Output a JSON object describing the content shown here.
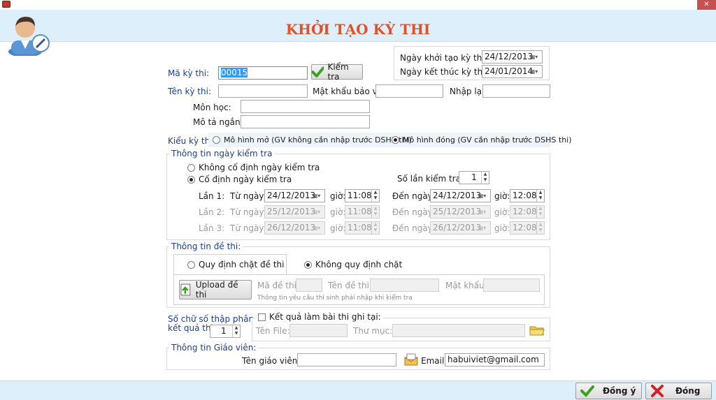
{
  "window": {
    "close_glyph": "✕"
  },
  "header": {
    "title": "KHỞI TẠO KỲ THI",
    "avatar_icon": "teacher-avatar-icon"
  },
  "dates": {
    "start_label": "Ngày khởi tạo kỳ thi:",
    "start_value": "24/12/2013",
    "end_label": "Ngày kết thúc kỳ thi:",
    "end_value": "24/01/2014"
  },
  "exam": {
    "code_label": "Mã kỳ thi:",
    "code_value": "00015",
    "check_button": "Kiểm tra",
    "name_label": "Tên kỳ thi:",
    "name_value": "",
    "password_label": "Mật khẩu bảo vệ:",
    "password_value": "",
    "reenter_label": "Nhập lại:",
    "reenter_value": "",
    "subject_label": "Môn học:",
    "subject_value": "",
    "desc_label": "Mô tả ngắn:",
    "desc_value": ""
  },
  "exam_type": {
    "label": "Kiểu kỳ thi:",
    "open_option": "Mô hình mở (GV không cần nhập trước DSHS thi)",
    "closed_option": "Mô hình đóng (GV cần nhập trước DSHS thi)",
    "selected": "closed"
  },
  "schedule": {
    "title": "Thông tin ngày kiểm tra",
    "not_fixed": "Không cố định ngày kiểm tra",
    "fixed": "Cố định ngày kiểm tra",
    "count_label": "Số lần kiểm tra:",
    "count_value": "1",
    "from_label": "Từ ngày:",
    "to_label": "Đến ngày:",
    "time_label": "giờ:",
    "rows": [
      {
        "label": "Lần 1:",
        "from_date": "24/12/2013",
        "from_time": "11:08",
        "to_date": "24/12/2013",
        "to_time": "12:08"
      },
      {
        "label": "Lần 2:",
        "from_date": "25/12/2013",
        "from_time": "11:08",
        "to_date": "25/12/2013",
        "to_time": "12:08"
      },
      {
        "label": "Lần 3:",
        "from_date": "26/12/2013",
        "from_time": "11:08",
        "to_date": "26/12/2013",
        "to_time": "12:08"
      }
    ]
  },
  "paper": {
    "title": "Thông tin đề thi:",
    "tab_strict": "Quy định chặt đề thi",
    "tab_loose": "Không quy định chặt",
    "upload_button": "Upload đề thi",
    "code_label": "Mã đề thi:",
    "name_label": "Tên đề thi:",
    "password_label": "Mật khẩu:",
    "hint": "Thông tin yêu cầu thí sinh phải nhập khi kiểm tra"
  },
  "decimal": {
    "label_line1": "Số chữ số thập phân",
    "label_line2": "kết quả thi:",
    "value": "1"
  },
  "result_save": {
    "checkbox_label": "Kết quả làm bài thi ghi tại:",
    "file_label": "Tên File:",
    "folder_label": "Thư mục:"
  },
  "teacher": {
    "title": "Thông tin Giáo viên:",
    "name_label": "Tên giáo viên:",
    "name_value": "",
    "email_label": "Email:",
    "email_value": "habuiviet@gmail.com"
  },
  "footer": {
    "ok": "Đồng ý",
    "close": "Đóng"
  },
  "colors": {
    "header_bg": "#dceffa",
    "title": "#e0522a",
    "label_blue": "#1c3f8f",
    "ok_check": "#3aa022",
    "close_x": "#d62020"
  }
}
